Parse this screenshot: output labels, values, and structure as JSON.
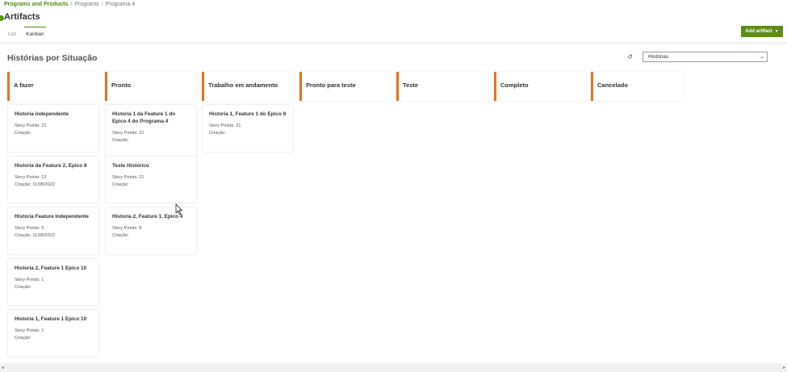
{
  "breadcrumb": [
    "Programs and Products",
    "Programs",
    "Programa 4"
  ],
  "page": {
    "title": "Artifacts"
  },
  "tabs": [
    "List",
    "Kanban"
  ],
  "active_tab": "Kanban",
  "actions": {
    "add_label": "Add artifact"
  },
  "board": {
    "title": "Histórias por Situação",
    "filter": "Histórias"
  },
  "columns": [
    {
      "label": "A fazer",
      "cards": [
        {
          "title": "Historia independente",
          "story_points": "Story Points: 21",
          "created": "Criação:"
        },
        {
          "title": "Historia da Feature 2, Epico 8",
          "story_points": "Story Points: 13",
          "created": "Criação: 11/08/2022"
        },
        {
          "title": "Historia Feature Independente",
          "story_points": "Story Points: 5",
          "created": "Criação: 11/08/2022"
        },
        {
          "title": "Historia 2, Feature 1 Epico 10",
          "story_points": "Story Points: 1",
          "created": "Criação:"
        },
        {
          "title": "Historia 1, Feature 1 Epico 10",
          "story_points": "Story Points: 1",
          "created": "Criação:"
        }
      ]
    },
    {
      "label": "Pronto",
      "cards": [
        {
          "title": "Historia 1 da Feature 1 do Epico 4 do Programa 4",
          "story_points": "Story Points: 21",
          "created": "Criação:"
        },
        {
          "title": "Teste Historico",
          "story_points": "Story Points: 21",
          "created": "Criação:"
        },
        {
          "title": "Historia 2, Feature 1, Epico 4",
          "story_points": "Story Points: 8",
          "created": "Criação:"
        }
      ]
    },
    {
      "label": "Trabalho em andamento",
      "cards": [
        {
          "title": "Historia 1, Feature 1 do Epico 9",
          "story_points": "Story Points: 21",
          "created": "Criação:"
        }
      ]
    },
    {
      "label": "Pronto para teste",
      "cards": []
    },
    {
      "label": "Teste",
      "cards": []
    },
    {
      "label": "Completo",
      "cards": []
    },
    {
      "label": "Cancelado",
      "cards": []
    }
  ]
}
